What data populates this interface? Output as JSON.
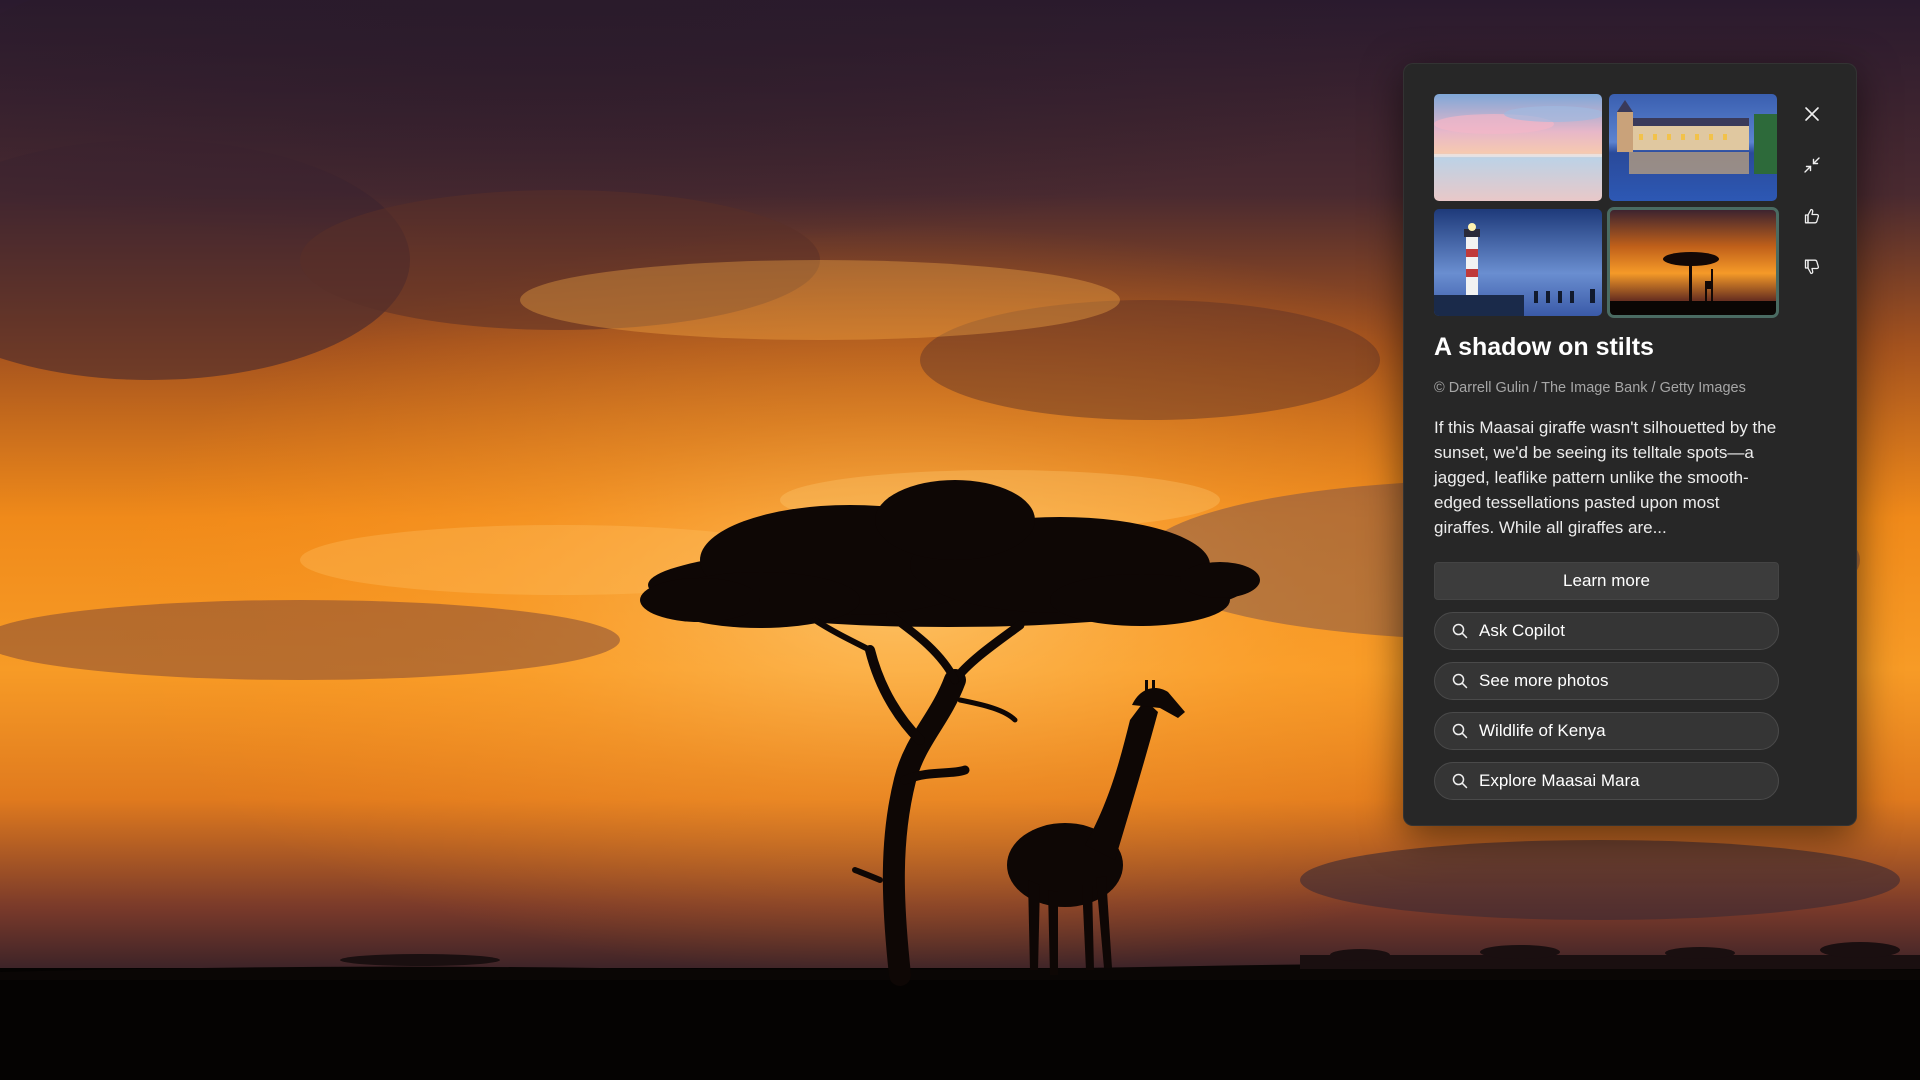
{
  "spotlight": {
    "title": "A shadow on stilts",
    "credit": "© Darrell Gulin / The Image Bank / Getty Images",
    "description": "If this Maasai giraffe wasn't silhouetted by the sunset, we'd be seeing its telltale spots—a jagged, leaflike pattern unlike the smooth-edged tessellations pasted upon most giraffes. While all giraffes are...",
    "learn_more_label": "Learn more",
    "queries": [
      {
        "label": "Ask Copilot",
        "icon": "search-icon"
      },
      {
        "label": "See more photos",
        "icon": "search-icon"
      },
      {
        "label": "Wildlife of Kenya",
        "icon": "search-icon"
      },
      {
        "label": "Explore Maasai Mara",
        "icon": "search-icon"
      }
    ],
    "thumbnails": [
      {
        "subject": "pastel-sea-sunset",
        "selected": false
      },
      {
        "subject": "chateau-reflection",
        "selected": false
      },
      {
        "subject": "lighthouse-dusk",
        "selected": false
      },
      {
        "subject": "giraffe-acacia-sunset",
        "selected": true
      }
    ],
    "side_icons": [
      "close-icon",
      "minimize-icon",
      "thumbs-up-icon",
      "thumbs-down-icon"
    ]
  },
  "colors": {
    "panel_bg": "#272727",
    "button_bg": "#3c3c3c",
    "query_bg": "#353535",
    "selected_outline": "#4a6b62",
    "text_primary": "#ffffff",
    "text_muted": "#a6a6a6"
  }
}
